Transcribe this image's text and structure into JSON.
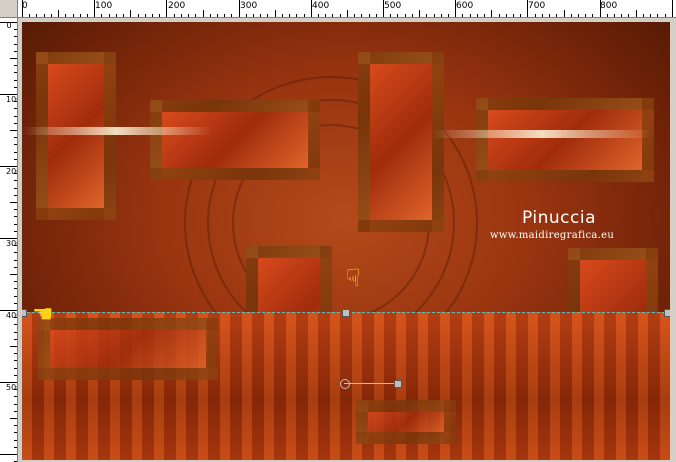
{
  "ruler_top": {
    "labels": [
      "0",
      "100",
      "200",
      "300",
      "400",
      "500",
      "600",
      "700",
      "800"
    ]
  },
  "ruler_left": {
    "labels": [
      "0",
      "100",
      "200",
      "300",
      "400",
      "500"
    ]
  },
  "watermark": {
    "title": "Pinuccia",
    "url": "www.maidiregrafica.eu"
  },
  "icons": {
    "pointer_hand_left": "pointing-hand-left-icon",
    "pointer_hand_down": "pointing-hand-down-icon"
  },
  "colors": {
    "guide": "#4fc3c3",
    "pointer": "#ffd21a"
  }
}
